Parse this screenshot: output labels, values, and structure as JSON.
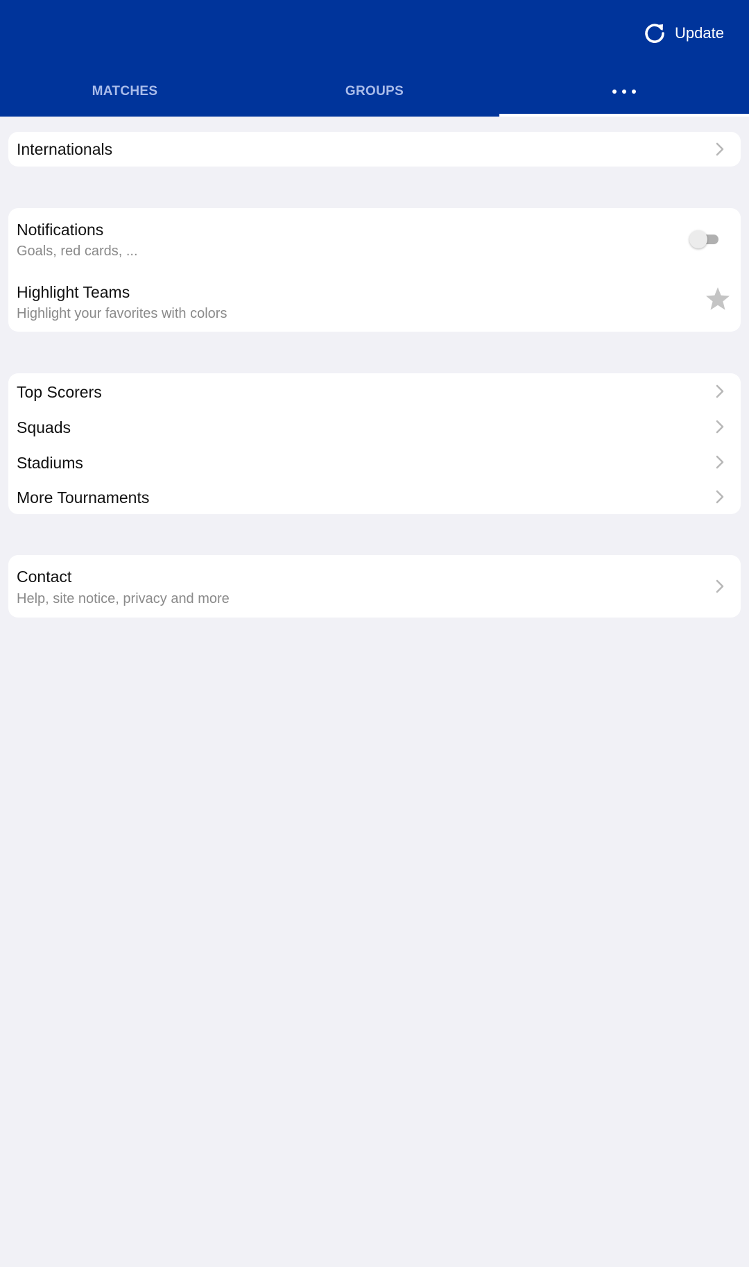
{
  "header": {
    "update_label": "Update",
    "update_icon": "refresh-icon",
    "background_color": "#00349b"
  },
  "tabs": [
    {
      "label": "MATCHES",
      "active": false
    },
    {
      "label": "GROUPS",
      "active": false
    },
    {
      "label": "",
      "icon": "more-dots-icon",
      "active": true
    }
  ],
  "sections": {
    "internationals": {
      "title": "Internationals"
    },
    "notifications": {
      "title": "Notifications",
      "subtitle": "Goals, red cards, ...",
      "enabled": false
    },
    "highlight_teams": {
      "title": "Highlight Teams",
      "subtitle": "Highlight your favorites with colors",
      "icon": "star-icon"
    },
    "top_scorers": {
      "title": "Top Scorers"
    },
    "squads": {
      "title": "Squads"
    },
    "stadiums": {
      "title": "Stadiums"
    },
    "more_tournaments": {
      "title": "More Tournaments"
    },
    "contact": {
      "title": "Contact",
      "subtitle": "Help, site notice, privacy and more"
    }
  }
}
